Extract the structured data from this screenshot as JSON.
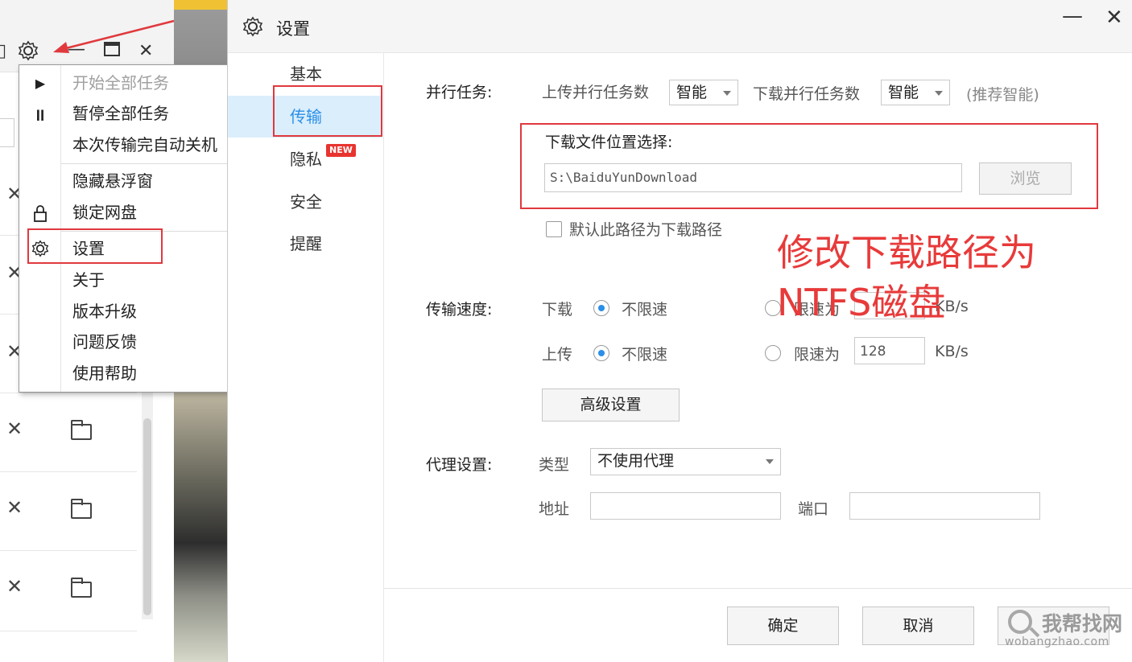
{
  "menu": {
    "items": [
      {
        "label": "开始全部任务",
        "disabled": true
      },
      {
        "label": "暂停全部任务"
      },
      {
        "label": "本次传输完自动关机"
      },
      {
        "label": "隐藏悬浮窗"
      },
      {
        "label": "锁定网盘"
      },
      {
        "label": "设置"
      },
      {
        "label": "关于"
      },
      {
        "label": "版本升级"
      },
      {
        "label": "问题反馈"
      },
      {
        "label": "使用帮助"
      }
    ]
  },
  "dialog": {
    "title": "设置",
    "nav": [
      {
        "label": "基本"
      },
      {
        "label": "传输",
        "active": true
      },
      {
        "label": "隐私",
        "badge": "NEW"
      },
      {
        "label": "安全"
      },
      {
        "label": "提醒"
      }
    ],
    "parallel": {
      "label": "并行任务:",
      "upload_label": "上传并行任务数",
      "upload_value": "智能",
      "download_label": "下载并行任务数",
      "download_value": "智能",
      "hint": "(推荐智能)"
    },
    "download_location": {
      "label": "下载文件位置选择:",
      "path": "S:\\BaiduYunDownload",
      "browse": "浏览",
      "default_checkbox": "默认此路径为下载路径"
    },
    "speed": {
      "label": "传输速度:",
      "download_label": "下载",
      "upload_label": "上传",
      "unlimited": "不限速",
      "limit": "限速为",
      "upload_limit_value": "128",
      "unit": "KB/s",
      "advanced": "高级设置"
    },
    "proxy": {
      "label": "代理设置:",
      "type_label": "类型",
      "type_value": "不使用代理",
      "address_label": "地址",
      "port_label": "端口"
    },
    "footer": {
      "ok": "确定",
      "cancel": "取消"
    }
  },
  "annotation": {
    "line1": "修改下载路径为",
    "line2": "NTFS磁盘"
  },
  "watermark": {
    "text": "我帮找网",
    "url": "wobangzhao.com"
  },
  "colors": {
    "accent": "#2a8fe6",
    "annotation_red": "#e83a3a",
    "highlight_box": "#e0393e"
  }
}
